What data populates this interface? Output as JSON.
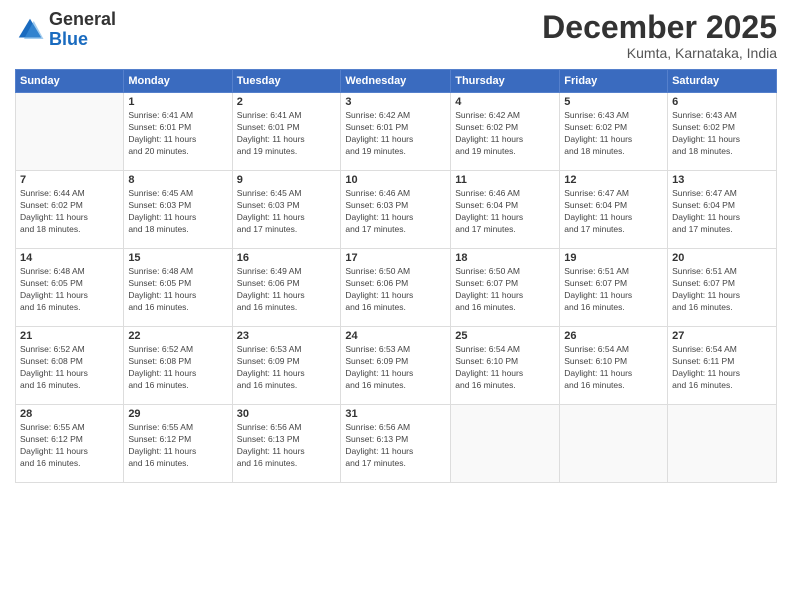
{
  "header": {
    "logo_general": "General",
    "logo_blue": "Blue",
    "month_title": "December 2025",
    "location": "Kumta, Karnataka, India"
  },
  "weekdays": [
    "Sunday",
    "Monday",
    "Tuesday",
    "Wednesday",
    "Thursday",
    "Friday",
    "Saturday"
  ],
  "weeks": [
    [
      {
        "day": "",
        "info": ""
      },
      {
        "day": "1",
        "info": "Sunrise: 6:41 AM\nSunset: 6:01 PM\nDaylight: 11 hours\nand 20 minutes."
      },
      {
        "day": "2",
        "info": "Sunrise: 6:41 AM\nSunset: 6:01 PM\nDaylight: 11 hours\nand 19 minutes."
      },
      {
        "day": "3",
        "info": "Sunrise: 6:42 AM\nSunset: 6:01 PM\nDaylight: 11 hours\nand 19 minutes."
      },
      {
        "day": "4",
        "info": "Sunrise: 6:42 AM\nSunset: 6:02 PM\nDaylight: 11 hours\nand 19 minutes."
      },
      {
        "day": "5",
        "info": "Sunrise: 6:43 AM\nSunset: 6:02 PM\nDaylight: 11 hours\nand 18 minutes."
      },
      {
        "day": "6",
        "info": "Sunrise: 6:43 AM\nSunset: 6:02 PM\nDaylight: 11 hours\nand 18 minutes."
      }
    ],
    [
      {
        "day": "7",
        "info": "Sunrise: 6:44 AM\nSunset: 6:02 PM\nDaylight: 11 hours\nand 18 minutes."
      },
      {
        "day": "8",
        "info": "Sunrise: 6:45 AM\nSunset: 6:03 PM\nDaylight: 11 hours\nand 18 minutes."
      },
      {
        "day": "9",
        "info": "Sunrise: 6:45 AM\nSunset: 6:03 PM\nDaylight: 11 hours\nand 17 minutes."
      },
      {
        "day": "10",
        "info": "Sunrise: 6:46 AM\nSunset: 6:03 PM\nDaylight: 11 hours\nand 17 minutes."
      },
      {
        "day": "11",
        "info": "Sunrise: 6:46 AM\nSunset: 6:04 PM\nDaylight: 11 hours\nand 17 minutes."
      },
      {
        "day": "12",
        "info": "Sunrise: 6:47 AM\nSunset: 6:04 PM\nDaylight: 11 hours\nand 17 minutes."
      },
      {
        "day": "13",
        "info": "Sunrise: 6:47 AM\nSunset: 6:04 PM\nDaylight: 11 hours\nand 17 minutes."
      }
    ],
    [
      {
        "day": "14",
        "info": "Sunrise: 6:48 AM\nSunset: 6:05 PM\nDaylight: 11 hours\nand 16 minutes."
      },
      {
        "day": "15",
        "info": "Sunrise: 6:48 AM\nSunset: 6:05 PM\nDaylight: 11 hours\nand 16 minutes."
      },
      {
        "day": "16",
        "info": "Sunrise: 6:49 AM\nSunset: 6:06 PM\nDaylight: 11 hours\nand 16 minutes."
      },
      {
        "day": "17",
        "info": "Sunrise: 6:50 AM\nSunset: 6:06 PM\nDaylight: 11 hours\nand 16 minutes."
      },
      {
        "day": "18",
        "info": "Sunrise: 6:50 AM\nSunset: 6:07 PM\nDaylight: 11 hours\nand 16 minutes."
      },
      {
        "day": "19",
        "info": "Sunrise: 6:51 AM\nSunset: 6:07 PM\nDaylight: 11 hours\nand 16 minutes."
      },
      {
        "day": "20",
        "info": "Sunrise: 6:51 AM\nSunset: 6:07 PM\nDaylight: 11 hours\nand 16 minutes."
      }
    ],
    [
      {
        "day": "21",
        "info": "Sunrise: 6:52 AM\nSunset: 6:08 PM\nDaylight: 11 hours\nand 16 minutes."
      },
      {
        "day": "22",
        "info": "Sunrise: 6:52 AM\nSunset: 6:08 PM\nDaylight: 11 hours\nand 16 minutes."
      },
      {
        "day": "23",
        "info": "Sunrise: 6:53 AM\nSunset: 6:09 PM\nDaylight: 11 hours\nand 16 minutes."
      },
      {
        "day": "24",
        "info": "Sunrise: 6:53 AM\nSunset: 6:09 PM\nDaylight: 11 hours\nand 16 minutes."
      },
      {
        "day": "25",
        "info": "Sunrise: 6:54 AM\nSunset: 6:10 PM\nDaylight: 11 hours\nand 16 minutes."
      },
      {
        "day": "26",
        "info": "Sunrise: 6:54 AM\nSunset: 6:10 PM\nDaylight: 11 hours\nand 16 minutes."
      },
      {
        "day": "27",
        "info": "Sunrise: 6:54 AM\nSunset: 6:11 PM\nDaylight: 11 hours\nand 16 minutes."
      }
    ],
    [
      {
        "day": "28",
        "info": "Sunrise: 6:55 AM\nSunset: 6:12 PM\nDaylight: 11 hours\nand 16 minutes."
      },
      {
        "day": "29",
        "info": "Sunrise: 6:55 AM\nSunset: 6:12 PM\nDaylight: 11 hours\nand 16 minutes."
      },
      {
        "day": "30",
        "info": "Sunrise: 6:56 AM\nSunset: 6:13 PM\nDaylight: 11 hours\nand 16 minutes."
      },
      {
        "day": "31",
        "info": "Sunrise: 6:56 AM\nSunset: 6:13 PM\nDaylight: 11 hours\nand 17 minutes."
      },
      {
        "day": "",
        "info": ""
      },
      {
        "day": "",
        "info": ""
      },
      {
        "day": "",
        "info": ""
      }
    ]
  ]
}
